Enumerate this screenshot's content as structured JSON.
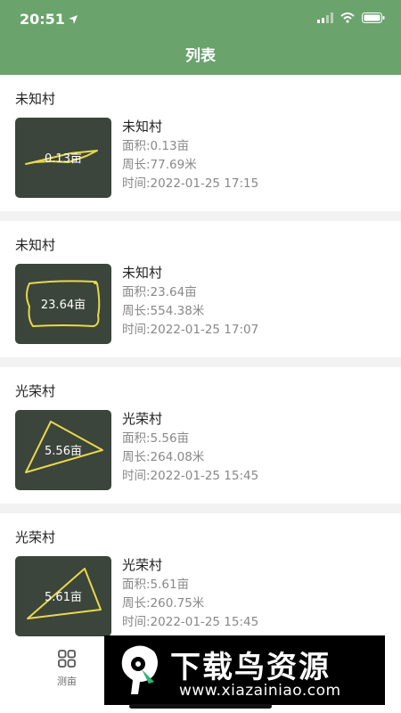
{
  "status": {
    "time": "20:51"
  },
  "nav": {
    "title": "列表"
  },
  "items": [
    {
      "group": "未知村",
      "thumb_label": "0.13亩",
      "name": "未知村",
      "area": "面积:0.13亩",
      "perimeter": "周长:77.69米",
      "time": "时间:2022-01-25 17:15"
    },
    {
      "group": "未知村",
      "thumb_label": "23.64亩",
      "name": "未知村",
      "area": "面积:23.64亩",
      "perimeter": "周长:554.38米",
      "time": "时间:2022-01-25 17:07"
    },
    {
      "group": "光荣村",
      "thumb_label": "5.56亩",
      "name": "光荣村",
      "area": "面积:5.56亩",
      "perimeter": "周长:264.08米",
      "time": "时间:2022-01-25 15:45"
    },
    {
      "group": "光荣村",
      "thumb_label": "5.61亩",
      "name": "光荣村",
      "area": "面积:5.61亩",
      "perimeter": "周长:260.75米",
      "time": "时间:2022-01-25 15:45"
    }
  ],
  "tabbar": {
    "measure_label": "测亩",
    "measure_icon": "grid-icon"
  },
  "watermark": {
    "text": "下载鸟资源",
    "url": "www.xiazainiao.com"
  },
  "colors": {
    "primary": "#6aa36c",
    "outline": "#e8d84a",
    "thumb_bg": "#3b453b"
  }
}
